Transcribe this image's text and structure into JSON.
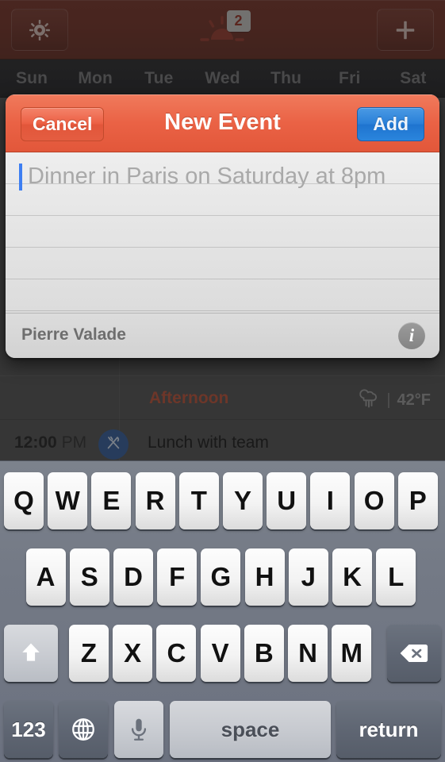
{
  "toolbar": {
    "gear_icon": "gear-icon",
    "plus_icon": "plus-icon",
    "sun_icon": "sunrise-icon",
    "badge_count": "2"
  },
  "weekdays": [
    "Sun",
    "Mon",
    "Tue",
    "Wed",
    "Thu",
    "Fri",
    "Sat"
  ],
  "day_view": {
    "section": {
      "label": "Afternoon",
      "weather_icon": "rain-cloud-icon",
      "separator": "|",
      "temperature": "42°F"
    },
    "events": [
      {
        "time_value": "12:00",
        "time_period": "PM",
        "icon": "fork-knife-icon",
        "title": "Lunch with team"
      }
    ]
  },
  "modal": {
    "cancel_label": "Cancel",
    "title": "New Event",
    "add_label": "Add",
    "input": {
      "value": "",
      "placeholder": "Dinner in Paris on Saturday at 8pm"
    },
    "footer": {
      "account_name": "Pierre Valade",
      "info_glyph": "i"
    }
  },
  "keyboard": {
    "row1": [
      "Q",
      "W",
      "E",
      "R",
      "T",
      "Y",
      "U",
      "I",
      "O",
      "P"
    ],
    "row2": [
      "A",
      "S",
      "D",
      "F",
      "G",
      "H",
      "J",
      "K",
      "L"
    ],
    "row3": [
      "Z",
      "X",
      "C",
      "V",
      "B",
      "N",
      "M"
    ],
    "shift_icon": "shift-up-arrow-icon",
    "backspace_icon": "backspace-delete-icon",
    "numeric_label": "123",
    "globe_icon": "globe-language-icon",
    "mic_icon": "microphone-icon",
    "space_label": "space",
    "return_label": "return"
  },
  "colors": {
    "toolbar_red": "#6a2b20",
    "modal_header_orange": "#ea6245",
    "add_button_blue": "#2a80d8",
    "section_label_red": "#b04a32",
    "caret_blue": "#3d7ef2",
    "event_icon_blue": "#2f5691",
    "keyboard_bg": "#737985"
  }
}
